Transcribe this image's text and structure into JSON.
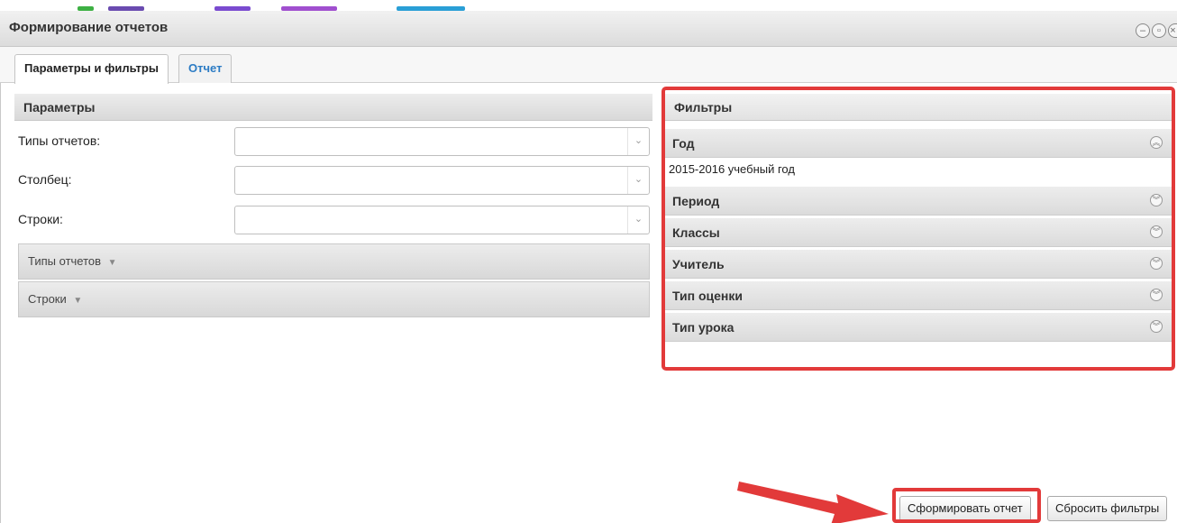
{
  "window": {
    "title": "Формирование отчетов",
    "controls": [
      "minimize-icon",
      "restore-icon",
      "close-icon"
    ]
  },
  "tabs": [
    {
      "label": "Параметры и фильтры",
      "active": true
    },
    {
      "label": "Отчет",
      "active": false
    }
  ],
  "params": {
    "header": "Параметры",
    "fields": [
      {
        "label": "Типы отчетов:",
        "value": ""
      },
      {
        "label": "Столбец:",
        "value": ""
      },
      {
        "label": "Строки:",
        "value": ""
      }
    ],
    "groups": [
      {
        "label": "Типы отчетов"
      },
      {
        "label": "Строки"
      }
    ]
  },
  "filters": {
    "header": "Фильтры",
    "items": [
      {
        "label": "Год",
        "expanded": true,
        "value": "2015-2016 учебный год"
      },
      {
        "label": "Период",
        "expanded": false
      },
      {
        "label": "Классы",
        "expanded": false
      },
      {
        "label": "Учитель",
        "expanded": false
      },
      {
        "label": "Тип оценки",
        "expanded": false
      },
      {
        "label": "Тип урока",
        "expanded": false
      }
    ]
  },
  "actions": {
    "generate": "Сформировать отчет",
    "reset": "Сбросить фильтры"
  },
  "colors": {
    "highlight": "#e23a3a",
    "tab_link": "#2b7bc4",
    "header_bg": "#dcdcdc"
  }
}
